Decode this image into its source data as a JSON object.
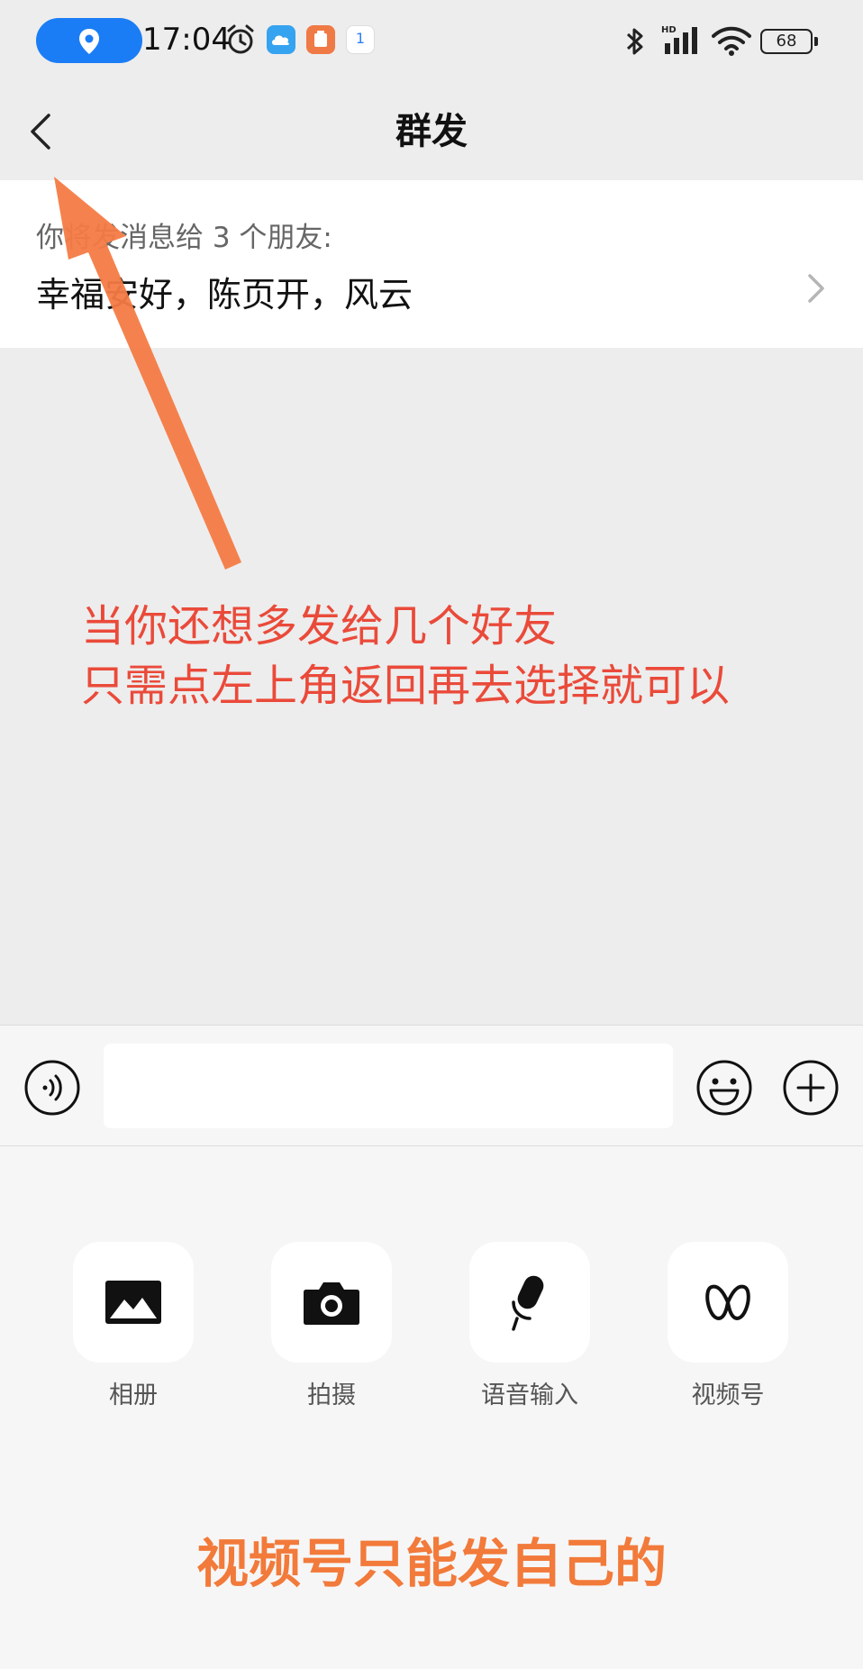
{
  "status_bar": {
    "time": "17:04",
    "calendar_day": "1",
    "battery": "68",
    "icons": [
      "location-icon",
      "alarm-icon",
      "cloud-app-icon",
      "orange-app-icon",
      "calendar-app-icon",
      "bluetooth-icon",
      "signal-icon",
      "wifi-icon",
      "battery-icon"
    ]
  },
  "nav": {
    "title": "群发"
  },
  "recipients": {
    "label": "你将发消息给 3 个朋友:",
    "names": "幸福安好，陈页开，风云"
  },
  "annotations": {
    "line1": "当你还想多发给几个好友",
    "line2": "只需点左上角返回再去选择就可以",
    "bottom": "视频号只能发自己的"
  },
  "input": {
    "value": "",
    "placeholder": ""
  },
  "tools": [
    {
      "label": "相册",
      "icon": "album-icon"
    },
    {
      "label": "拍摄",
      "icon": "camera-icon"
    },
    {
      "label": "语音输入",
      "icon": "microphone-icon"
    },
    {
      "label": "视频号",
      "icon": "channels-icon"
    }
  ],
  "colors": {
    "background": "#ededed",
    "panel": "#f6f6f6",
    "annotation_red": "#ea4a3a",
    "annotation_orange": "#f27a3a",
    "arrow": "#f47b45",
    "location_pill": "#1a7df5"
  }
}
